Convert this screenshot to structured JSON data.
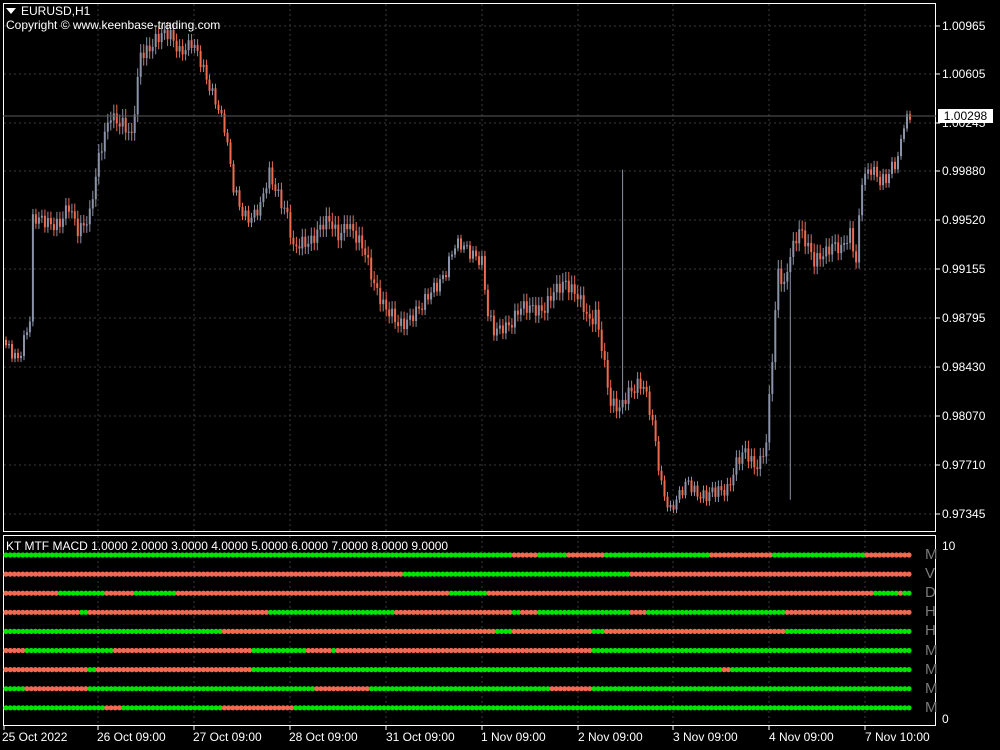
{
  "window": {
    "symbol": "EURUSD,H1",
    "copyright": "Copyright © www.keenbase-trading.com",
    "current_price": "1.00298"
  },
  "colors": {
    "background": "#000000",
    "grid": "#3a3a3a",
    "bull_candle": "#8a93a8",
    "bear_candle": "#f06a50",
    "macd_up": "#00e400",
    "macd_down": "#f06a50",
    "text": "#ffffff",
    "timeframe_label": "#7a7a7a"
  },
  "price_axis": {
    "labels": [
      "1.00965",
      "1.00605",
      "1.00245",
      "0.99880",
      "0.99520",
      "0.99155",
      "0.98795",
      "0.98430",
      "0.98070",
      "0.97710",
      "0.97345"
    ],
    "min": 0.9725,
    "max": 1.0105
  },
  "time_axis": {
    "labels": [
      "25 Oct 2022",
      "26 Oct 09:00",
      "27 Oct 09:00",
      "28 Oct 09:00",
      "31 Oct 09:00",
      "1 Nov 09:00",
      "2 Nov 09:00",
      "3 Nov 09:00",
      "4 Nov 09:00",
      "7 Nov 10:00"
    ]
  },
  "indicator": {
    "title": "KT MTF MACD 1.0000 2.0000 3.0000 4.0000 5.0000 6.0000 7.0000 8.0000 9.0000",
    "scale_max": "10",
    "scale_min": "0",
    "rows": [
      {
        "label": "M",
        "segments": [
          [
            "up",
            0.56
          ],
          [
            "down",
            0.59
          ],
          [
            "up",
            0.62
          ],
          [
            "down",
            0.66
          ],
          [
            "up",
            0.78
          ],
          [
            "down",
            0.85
          ],
          [
            "up",
            0.95
          ],
          [
            "down",
            1.0
          ]
        ]
      },
      {
        "label": "V",
        "segments": [
          [
            "down",
            0.44
          ],
          [
            "up",
            0.69
          ],
          [
            "down",
            1.0
          ]
        ]
      },
      {
        "label": "D",
        "segments": [
          [
            "down",
            0.06
          ],
          [
            "up",
            0.11
          ],
          [
            "down",
            0.14
          ],
          [
            "up",
            0.19
          ],
          [
            "down",
            0.49
          ],
          [
            "up",
            0.53
          ],
          [
            "down",
            0.96
          ],
          [
            "up",
            0.985
          ],
          [
            "down",
            0.99
          ],
          [
            "up",
            1.0
          ]
        ]
      },
      {
        "label": "H",
        "segments": [
          [
            "down",
            0.08
          ],
          [
            "up",
            0.09
          ],
          [
            "down",
            0.29
          ],
          [
            "up",
            0.43
          ],
          [
            "down",
            0.56
          ],
          [
            "up",
            0.57
          ],
          [
            "down",
            0.59
          ],
          [
            "up",
            0.69
          ],
          [
            "down",
            0.71
          ],
          [
            "up",
            0.86
          ],
          [
            "down",
            1.0
          ]
        ]
      },
      {
        "label": "H",
        "segments": [
          [
            "up",
            0.24
          ],
          [
            "down",
            0.54
          ],
          [
            "up",
            0.56
          ],
          [
            "down",
            0.65
          ],
          [
            "up",
            0.66
          ],
          [
            "down",
            0.86
          ],
          [
            "up",
            1.0
          ]
        ]
      },
      {
        "label": "M",
        "segments": [
          [
            "down",
            0.02
          ],
          [
            "up",
            0.12
          ],
          [
            "down",
            0.27
          ],
          [
            "up",
            0.33
          ],
          [
            "down",
            0.36
          ],
          [
            "up",
            0.365
          ],
          [
            "down",
            0.65
          ],
          [
            "up",
            1.0
          ]
        ]
      },
      {
        "label": "M",
        "segments": [
          [
            "down",
            0.09
          ],
          [
            "up",
            0.1
          ],
          [
            "down",
            0.27
          ],
          [
            "up",
            0.79
          ],
          [
            "down",
            0.8
          ],
          [
            "up",
            1.0
          ]
        ]
      },
      {
        "label": "M",
        "segments": [
          [
            "up",
            0.02
          ],
          [
            "down",
            0.09
          ],
          [
            "up",
            0.34
          ],
          [
            "down",
            0.4
          ],
          [
            "up",
            0.6
          ],
          [
            "down",
            0.65
          ],
          [
            "up",
            1.0
          ]
        ]
      },
      {
        "label": "M",
        "segments": [
          [
            "up",
            0.11
          ],
          [
            "down",
            0.13
          ],
          [
            "up",
            0.24
          ],
          [
            "down",
            0.32
          ],
          [
            "up",
            1.0
          ]
        ]
      }
    ]
  },
  "chart_data": {
    "type": "candlestick",
    "title": "EURUSD,H1",
    "ylim": [
      0.9725,
      1.0105
    ],
    "anchors": [
      [
        0,
        0.9857
      ],
      [
        4,
        0.9852
      ],
      [
        8,
        0.9878
      ],
      [
        9,
        0.995
      ],
      [
        14,
        0.9953
      ],
      [
        18,
        0.995
      ],
      [
        21,
        0.996
      ],
      [
        24,
        0.9946
      ],
      [
        28,
        0.9958
      ],
      [
        31,
        0.9996
      ],
      [
        35,
        1.0032
      ],
      [
        39,
        1.0025
      ],
      [
        42,
        1.0011
      ],
      [
        45,
        1.0076
      ],
      [
        50,
        1.0087
      ],
      [
        55,
        1.0089
      ],
      [
        58,
        1.008
      ],
      [
        62,
        1.0083
      ],
      [
        66,
        1.0063
      ],
      [
        70,
        1.0044
      ],
      [
        73,
        1.002
      ],
      [
        76,
        0.9975
      ],
      [
        79,
        0.996
      ],
      [
        82,
        0.9955
      ],
      [
        85,
        0.996
      ],
      [
        88,
        0.9987
      ],
      [
        91,
        0.9974
      ],
      [
        94,
        0.9955
      ],
      [
        96,
        0.9928
      ],
      [
        99,
        0.9936
      ],
      [
        102,
        0.994
      ],
      [
        105,
        0.9946
      ],
      [
        108,
        0.995
      ],
      [
        111,
        0.9943
      ],
      [
        114,
        0.9952
      ],
      [
        117,
        0.9937
      ],
      [
        120,
        0.9928
      ],
      [
        123,
        0.9908
      ],
      [
        127,
        0.9884
      ],
      [
        131,
        0.9875
      ],
      [
        135,
        0.9882
      ],
      [
        139,
        0.9886
      ],
      [
        143,
        0.9904
      ],
      [
        147,
        0.9915
      ],
      [
        150,
        0.9931
      ],
      [
        153,
        0.9934
      ],
      [
        156,
        0.993
      ],
      [
        159,
        0.992
      ],
      [
        161,
        0.988
      ],
      [
        163,
        0.987
      ],
      [
        166,
        0.9876
      ],
      [
        169,
        0.9876
      ],
      [
        172,
        0.9885
      ],
      [
        176,
        0.989
      ],
      [
        180,
        0.9886
      ],
      [
        184,
        0.99
      ],
      [
        187,
        0.9909
      ],
      [
        190,
        0.99
      ],
      [
        193,
        0.9885
      ],
      [
        195,
        0.9875
      ],
      [
        197,
        0.9885
      ],
      [
        199,
        0.9862
      ],
      [
        202,
        0.9815
      ],
      [
        205,
        0.981
      ],
      [
        208,
        0.9827
      ],
      [
        211,
        0.9832
      ],
      [
        213,
        0.9828
      ],
      [
        216,
        0.98
      ],
      [
        219,
        0.9758
      ],
      [
        222,
        0.9738
      ],
      [
        225,
        0.9746
      ],
      [
        228,
        0.9758
      ],
      [
        231,
        0.9752
      ],
      [
        234,
        0.9747
      ],
      [
        237,
        0.9749
      ],
      [
        241,
        0.9755
      ],
      [
        244,
        0.9773
      ],
      [
        247,
        0.9778
      ],
      [
        250,
        0.977
      ],
      [
        252,
        0.9776
      ],
      [
        254,
        0.979
      ],
      [
        256,
        0.985
      ],
      [
        258,
        0.9912
      ],
      [
        260,
        0.9902
      ],
      [
        262,
        0.993
      ],
      [
        265,
        0.9947
      ],
      [
        268,
        0.993
      ],
      [
        270,
        0.992
      ],
      [
        273,
        0.993
      ],
      [
        276,
        0.9935
      ],
      [
        279,
        0.9928
      ],
      [
        282,
        0.9942
      ],
      [
        284,
        0.9925
      ],
      [
        286,
        0.9985
      ],
      [
        289,
        0.9988
      ],
      [
        292,
        0.998
      ],
      [
        294,
        0.9985
      ],
      [
        296,
        0.9995
      ],
      [
        298,
        0.9998
      ],
      [
        300,
        1.0022
      ],
      [
        302,
        1.0026
      ]
    ],
    "spikes": [
      [
        206,
        0.999,
        0.9836
      ],
      [
        262,
        0.988,
        0.9745
      ]
    ]
  }
}
